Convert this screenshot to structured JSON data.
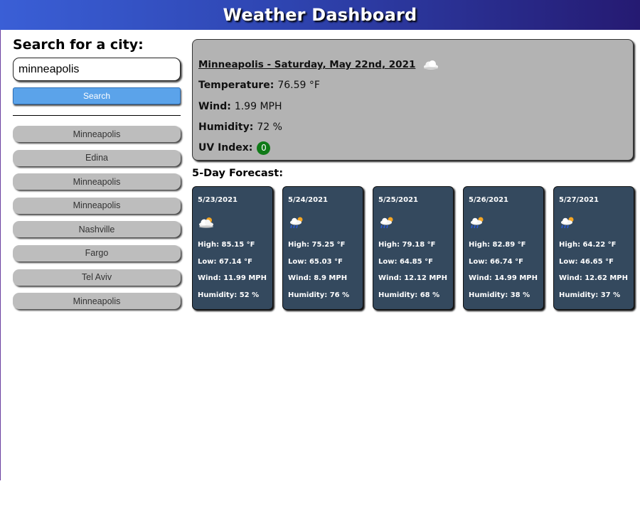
{
  "header": {
    "title": "Weather Dashboard"
  },
  "search": {
    "heading": "Search for a city:",
    "value": "minneapolis",
    "button_label": "Search"
  },
  "history": [
    "Minneapolis",
    "Edina",
    "Minneapolis",
    "Minneapolis",
    "Nashville",
    "Fargo",
    "Tel Aviv",
    "Minneapolis"
  ],
  "current": {
    "title": "Minneapolis - Saturday, May 22nd, 2021",
    "icon": "cloud-icon",
    "temperature_label": "Temperature:",
    "temperature_value": "76.59 °F",
    "wind_label": "Wind:",
    "wind_value": "1.99 MPH",
    "humidity_label": "Humidity:",
    "humidity_value": "72 %",
    "uv_label": "UV Index:",
    "uv_value": "0",
    "uv_color": "#0f7a17"
  },
  "forecast": {
    "heading": "5-Day Forecast:",
    "days": [
      {
        "date": "5/23/2021",
        "icon": "sun-cloud-icon",
        "high": "High: 85.15 °F",
        "low": "Low: 67.14 °F",
        "wind": "Wind: 11.99 MPH",
        "humidity": "Humidity: 52 %"
      },
      {
        "date": "5/24/2021",
        "icon": "sun-rain-icon",
        "high": "High: 75.25 °F",
        "low": "Low: 65.03 °F",
        "wind": "Wind: 8.9 MPH",
        "humidity": "Humidity: 76 %"
      },
      {
        "date": "5/25/2021",
        "icon": "sun-rain-icon",
        "high": "High: 79.18 °F",
        "low": "Low: 64.85 °F",
        "wind": "Wind: 12.12 MPH",
        "humidity": "Humidity: 68 %"
      },
      {
        "date": "5/26/2021",
        "icon": "sun-rain-icon",
        "high": "High: 82.89 °F",
        "low": "Low: 66.74 °F",
        "wind": "Wind: 14.99 MPH",
        "humidity": "Humidity: 38 %"
      },
      {
        "date": "5/27/2021",
        "icon": "sun-rain-icon",
        "high": "High: 64.22 °F",
        "low": "Low: 46.65 °F",
        "wind": "Wind: 12.62 MPH",
        "humidity": "Humidity: 37 %"
      }
    ]
  },
  "colors": {
    "header_start": "#3a5fd6",
    "header_end": "#251a72",
    "search_button": "#5ba3ea",
    "current_panel": "#b3b3b3",
    "forecast_card": "#34495e"
  }
}
